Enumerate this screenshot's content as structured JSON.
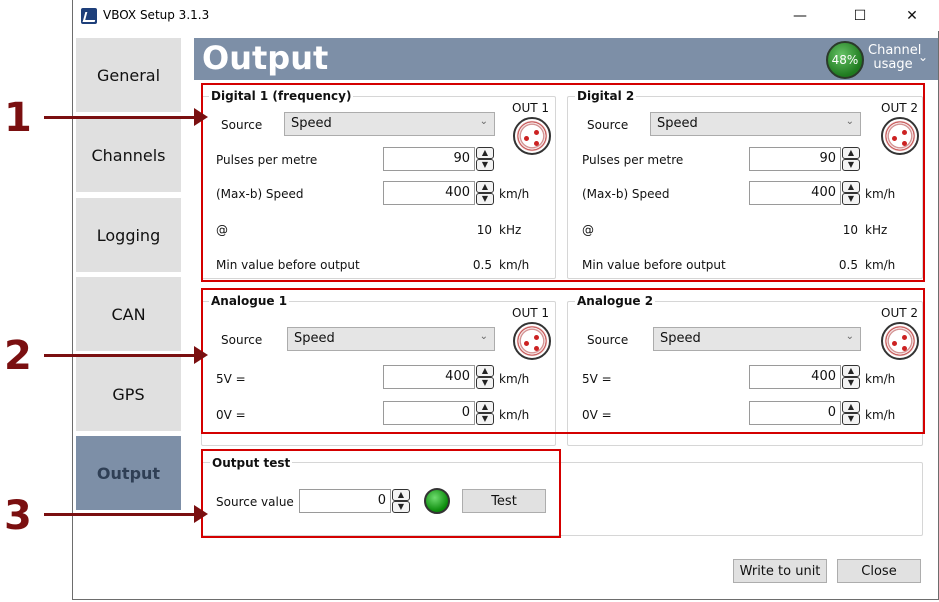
{
  "window": {
    "title": "VBOX Setup 3.1.3",
    "controls": [
      "—",
      "☐",
      "✕"
    ]
  },
  "sidebar": {
    "items": [
      {
        "label": "General",
        "active": false
      },
      {
        "label": "Channels",
        "active": false
      },
      {
        "label": "Logging",
        "active": false
      },
      {
        "label": "CAN",
        "active": false
      },
      {
        "label": "GPS",
        "active": false
      },
      {
        "label": "Output",
        "active": true
      }
    ]
  },
  "header": {
    "title": "Output",
    "usage_percent": "48%",
    "usage_label_line1": "Channel",
    "usage_label_line2": "usage"
  },
  "digital1": {
    "title": "Digital 1 (frequency)",
    "out": "OUT 1",
    "source_label": "Source",
    "source_value": "Speed",
    "pulses_label": "Pulses per metre",
    "pulses_value": "90",
    "maxspeed_label": "(Max-b) Speed",
    "maxspeed_value": "400",
    "maxspeed_unit": "km/h",
    "at_label": "@",
    "at_value": "10",
    "at_unit": "kHz",
    "min_label": "Min value before output",
    "min_value": "0.5",
    "min_unit": "km/h"
  },
  "digital2": {
    "title": "Digital 2",
    "out": "OUT 2",
    "source_label": "Source",
    "source_value": "Speed",
    "pulses_label": "Pulses per metre",
    "pulses_value": "90",
    "maxspeed_label": "(Max-b) Speed",
    "maxspeed_value": "400",
    "maxspeed_unit": "km/h",
    "at_label": "@",
    "at_value": "10",
    "at_unit": "kHz",
    "min_label": "Min value before output",
    "min_value": "0.5",
    "min_unit": "km/h"
  },
  "analogue1": {
    "title": "Analogue 1",
    "out": "OUT 1",
    "source_label": "Source",
    "source_value": "Speed",
    "v5_label": "5V =",
    "v5_value": "400",
    "v5_unit": "km/h",
    "v0_label": "0V =",
    "v0_value": "0",
    "v0_unit": "km/h"
  },
  "analogue2": {
    "title": "Analogue 2",
    "out": "OUT 2",
    "source_label": "Source",
    "source_value": "Speed",
    "v5_label": "5V =",
    "v5_value": "400",
    "v5_unit": "km/h",
    "v0_label": "0V =",
    "v0_value": "0",
    "v0_unit": "km/h"
  },
  "output_test": {
    "title": "Output test",
    "source_label": "Source value",
    "source_value": "0",
    "test_button": "Test"
  },
  "footer": {
    "write_button": "Write to unit",
    "close_button": "Close"
  },
  "annotations": {
    "m1": "1",
    "m2": "2",
    "m3": "3"
  },
  "colors": {
    "accent": "#7d8fa7",
    "highlight_red": "#d40000",
    "marker": "#7a0f10",
    "led_green": "#0a8a0a"
  }
}
